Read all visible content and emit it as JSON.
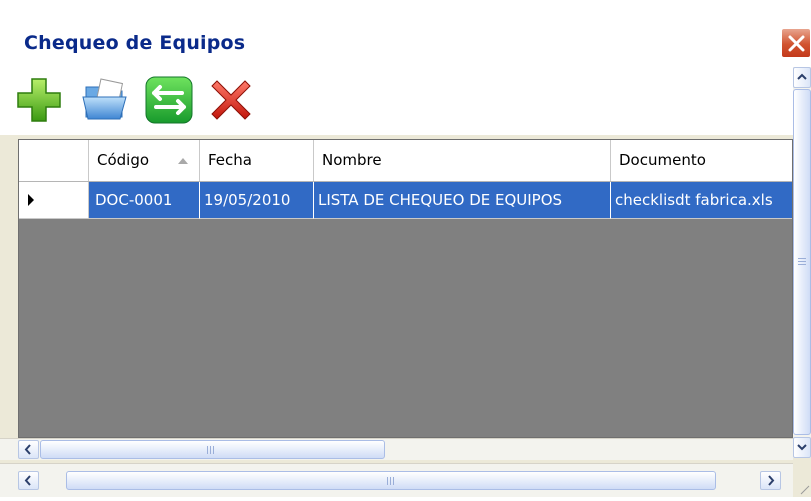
{
  "window": {
    "title": "Chequeo de Equipos"
  },
  "toolbar": {
    "buttons": [
      {
        "icon": "add-icon"
      },
      {
        "icon": "open-folder-icon"
      },
      {
        "icon": "swap-arrows-icon"
      },
      {
        "icon": "delete-x-icon"
      }
    ]
  },
  "grid": {
    "columns": [
      "Código",
      "Fecha",
      "Nombre",
      "Documento"
    ],
    "sort": {
      "column": "Código",
      "direction": "ascending"
    },
    "rows": [
      {
        "codigo": "DOC-0001",
        "fecha": "19/05/2010",
        "nombre": "LISTA DE CHEQUEO DE EQUIPOS",
        "documento": "checklisdt fabrica.xls"
      }
    ]
  },
  "colors": {
    "selection": "#316ac5",
    "grid_background": "#808080",
    "title_text": "#0a2a8a"
  }
}
